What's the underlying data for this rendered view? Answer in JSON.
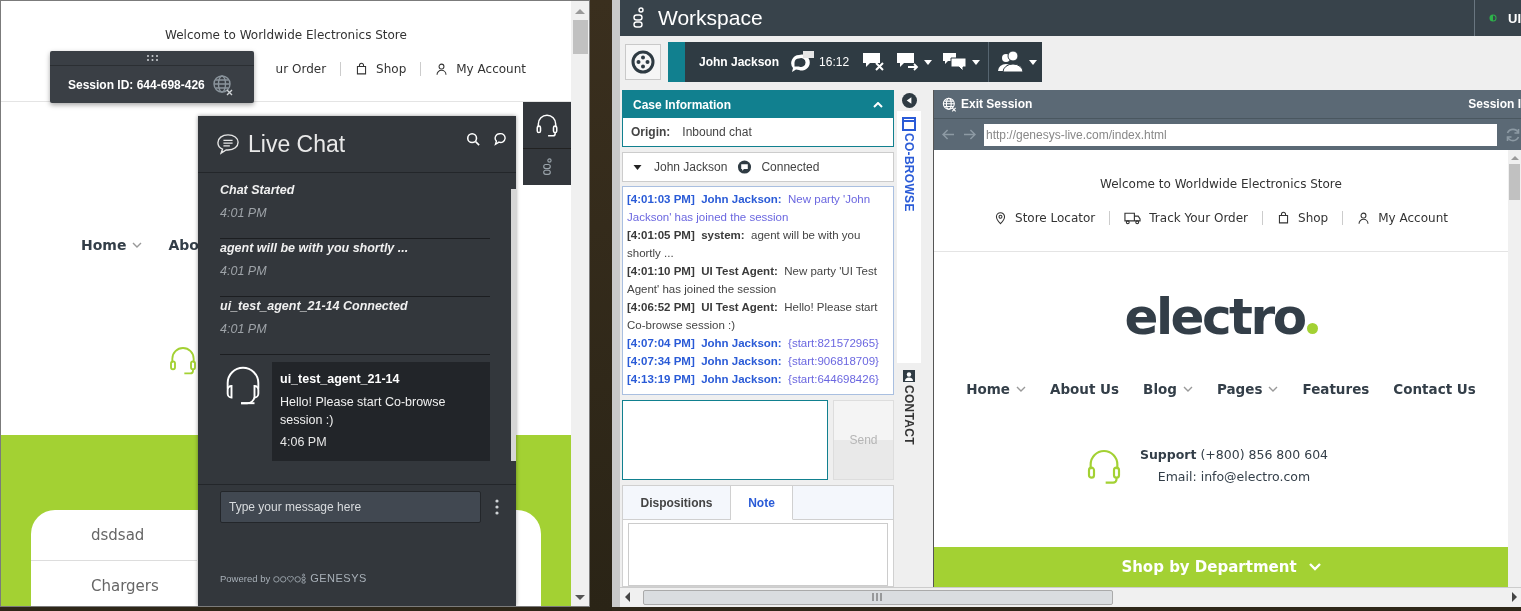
{
  "store_page": {
    "welcome": "Welcome to Worldwide Electronics Store",
    "top_links": [
      {
        "label": "ur Order",
        "kind": "plain"
      },
      {
        "label": "Shop",
        "kind": "bag"
      },
      {
        "label": "My Account",
        "kind": "user"
      }
    ],
    "nav": [
      {
        "label": "Home",
        "dropdown": true
      },
      {
        "label": "Abo"
      }
    ],
    "categories": [
      "dsdsad",
      "Chargers"
    ]
  },
  "session_popup": {
    "text": "Session ID: 644-698-426"
  },
  "live_chat": {
    "title": "Live Chat",
    "messages": [
      {
        "kind": "event",
        "text": "Chat Started",
        "time": "4:01 PM"
      },
      {
        "kind": "event",
        "text": "agent will be with you shortly ...",
        "time": "4:01 PM"
      },
      {
        "kind": "event",
        "text": "ui_test_agent_21-14 Connected",
        "time": "4:01 PM"
      },
      {
        "kind": "agent",
        "sender": "ui_test_agent_21-14",
        "text": "Hello! Please start Co-browse session :)",
        "time": "4:06 PM"
      }
    ],
    "input": {
      "placeholder": "Type your message here"
    },
    "footer": {
      "powered_by": "Powered by",
      "brand": "GENESYS"
    }
  },
  "workspace": {
    "title": "Workspace",
    "user": "UI",
    "interaction": {
      "contact": "John Jackson",
      "timer": "16:12"
    },
    "case_information": {
      "title": "Case Information",
      "expanded": true,
      "fields": [
        {
          "label": "Origin:",
          "value": "Inbound chat"
        }
      ]
    },
    "party": {
      "name": "John Jackson",
      "status": "Connected"
    },
    "transcript": [
      {
        "kind": "customer",
        "time": "[4:01:03 PM]",
        "sender": "John Jackson:",
        "text": "New party 'John Jackson' has joined the session"
      },
      {
        "kind": "system",
        "time": "[4:01:05 PM]",
        "sender": "system:",
        "text": "agent will be with you shortly ..."
      },
      {
        "kind": "agent",
        "time": "[4:01:10 PM]",
        "sender": "UI Test Agent:",
        "text": "New party 'UI Test Agent' has joined the session"
      },
      {
        "kind": "agent",
        "time": "[4:06:52 PM]",
        "sender": "UI Test Agent:",
        "text": "Hello! Please start Co-browse session :)"
      },
      {
        "kind": "customer",
        "time": "[4:07:04 PM]",
        "sender": "John Jackson:",
        "text": "{start:821572965}"
      },
      {
        "kind": "customer",
        "time": "[4:07:34 PM]",
        "sender": "John Jackson:",
        "text": "{start:906818709}"
      },
      {
        "kind": "customer",
        "time": "[4:13:19 PM]",
        "sender": "John Jackson:",
        "text": "{start:644698426}"
      }
    ],
    "send_button": {
      "label": "Send",
      "disabled": true
    },
    "tabs": [
      {
        "label": "Dispositions",
        "selected": false
      },
      {
        "label": "Note",
        "selected": true
      }
    ],
    "side_tabs": [
      {
        "label": "CO-BROWSE",
        "selected": true
      },
      {
        "label": "CONTACT",
        "selected": false
      }
    ],
    "cobrowse": {
      "exit_label": "Exit Session",
      "session_label": "Session I",
      "url": "http://genesys-live.com/index.html",
      "page": {
        "welcome": "Welcome to Worldwide Electronics Store",
        "links": [
          {
            "label": "Store Locator",
            "kind": "pin"
          },
          {
            "label": "Track Your Order",
            "kind": "truck"
          },
          {
            "label": "Shop",
            "kind": "bag"
          },
          {
            "label": "My Account",
            "kind": "user"
          }
        ],
        "logo": "electro",
        "nav": [
          {
            "label": "Home",
            "dropdown": true
          },
          {
            "label": "About Us",
            "dropdown": false
          },
          {
            "label": "Blog",
            "dropdown": true
          },
          {
            "label": "Pages",
            "dropdown": true
          },
          {
            "label": "Features",
            "dropdown": false
          },
          {
            "label": "Contact Us",
            "dropdown": false
          }
        ],
        "support": "**Support** (+800) 856 800 604",
        "email": "Email: info@electro.com",
        "band": "Shop by Department"
      }
    }
  }
}
